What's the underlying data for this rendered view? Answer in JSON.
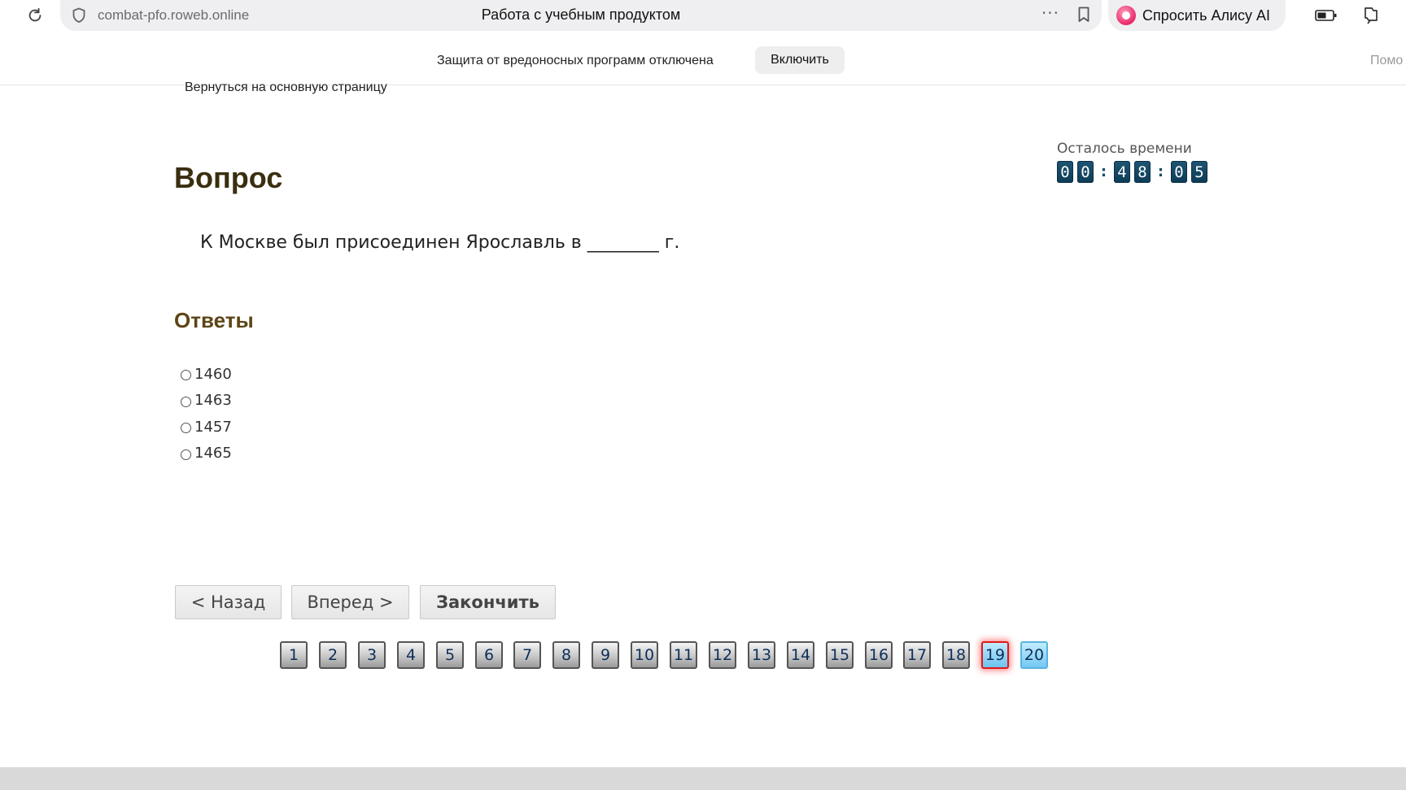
{
  "browser": {
    "url": "combat-pfo.roweb.online",
    "page_title": "Работа с учебным продуктом",
    "alice_label": "Спросить Алису AI"
  },
  "protection_bar": {
    "message": "Защита от вредоносных программ отключена",
    "enable_label": "Включить",
    "help_label": "Помо"
  },
  "page": {
    "back_link": "Вернуться на основную страницу",
    "question_heading": "Вопрос",
    "question_text": "К Москве был присоединен Ярославль в ________ г.",
    "answers_heading": "Ответы",
    "answers": [
      "1460",
      "1463",
      "1457",
      "1465"
    ],
    "timer_label": "Осталось времени",
    "timer_digits": [
      "0",
      "0",
      "4",
      "8",
      "0",
      "5"
    ],
    "timer_separator": ":",
    "buttons": {
      "back": "< Назад",
      "next": "Вперед >",
      "finish": "Закончить"
    },
    "pages": [
      "1",
      "2",
      "3",
      "4",
      "5",
      "6",
      "7",
      "8",
      "9",
      "10",
      "11",
      "12",
      "13",
      "14",
      "15",
      "16",
      "17",
      "18",
      "19",
      "20"
    ],
    "current_page": "19",
    "highlighted_page": "20"
  },
  "colors": {
    "heading": "#3b2e10",
    "answers_heading": "#5c4516",
    "timer_digit_bg": "#0d3c56",
    "current_page_border": "#e01818",
    "highlight_page_bg": "#73c8f2"
  }
}
